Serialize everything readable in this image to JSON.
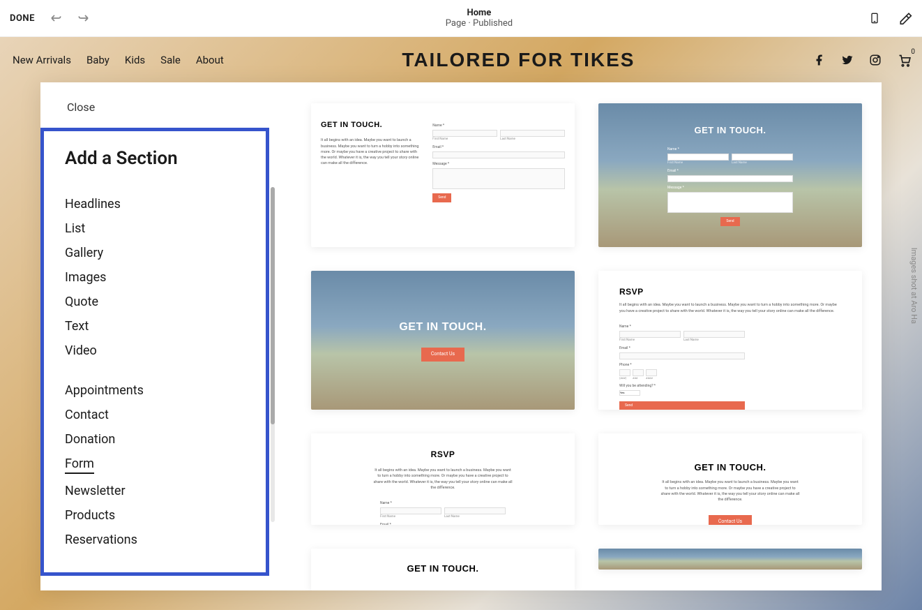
{
  "topbar": {
    "done": "DONE",
    "title": "Home",
    "subtitle": "Page · Published"
  },
  "site": {
    "nav": [
      "New Arrivals",
      "Baby",
      "Kids",
      "Sale",
      "About"
    ],
    "logo": "TAILORED FOR TIKES",
    "cart_count": "0"
  },
  "panel": {
    "close": "Close",
    "title": "Add a Section",
    "group1": [
      "Headlines",
      "List",
      "Gallery",
      "Images",
      "Quote",
      "Text",
      "Video"
    ],
    "group2": [
      "Appointments",
      "Contact",
      "Donation",
      "Form",
      "Newsletter",
      "Products",
      "Reservations"
    ],
    "active": "Form"
  },
  "templates": {
    "get_in_touch_title": "GET IN TOUCH.",
    "rsvp_title": "RSVP",
    "desc": "It all begins with an idea. Maybe you want to launch a business. Maybe you want to turn a hobby into something more. Or maybe you have a creative project to share with the world. Whatever it is, the way you tell your story online can make all the difference.",
    "desc_short": "It all begins with an idea. Maybe you want to launch a business. Maybe you want to turn a hobby into something more. Or maybe you have a creative project to share with the world. Whatever it is, the way you tell your story online can make all the difference.",
    "labels": {
      "name": "Name *",
      "first_name": "First Name",
      "last_name": "Last Name",
      "email": "Email *",
      "message": "Message *",
      "phone": "Phone *",
      "attending": "Will you be attending? *",
      "yes": "Yes",
      "p1": "(###)",
      "p2": "###",
      "p3": "####"
    },
    "buttons": {
      "send": "Send",
      "contact": "Contact Us"
    }
  },
  "credit": "Images shot at Aro Ha"
}
